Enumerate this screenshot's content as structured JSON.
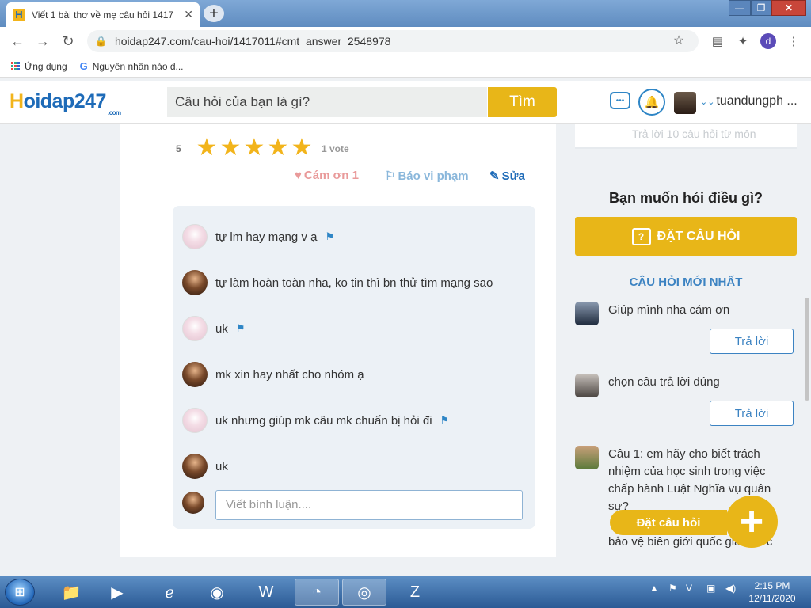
{
  "browser": {
    "tab_title": "Viết 1 bài thơ về mẹ câu hỏi 1417",
    "new_tab": "+",
    "url": "hoidap247.com/cau-hoi/1417011#cmt_answer_2548978",
    "profile_initial": "d",
    "bookmarks": [
      "Ứng dụng",
      "Nguyên nhân nào d..."
    ]
  },
  "site": {
    "logo_h": "H",
    "logo_rest": "oidap247",
    "logo_com": ".com",
    "search_placeholder": "Câu hỏi của bạn là gì?",
    "search_button": "Tìm",
    "username": "tuandungph ..."
  },
  "answer": {
    "rating": "5",
    "stars": 5,
    "votes": "1 vote",
    "thanks": "Cám ơn 1",
    "report": "Báo vi phạm",
    "edit": "Sửa"
  },
  "comments": [
    {
      "text": "tự lm hay mạng v ạ",
      "avatar": "a",
      "flag": true
    },
    {
      "text": "tự làm hoàn toàn nha, ko tin thì bn thử tìm mạng sao",
      "avatar": "b",
      "flag": false
    },
    {
      "text": "uk",
      "avatar": "a",
      "flag": true
    },
    {
      "text": "mk xin hay nhất cho nhóm ạ",
      "avatar": "b",
      "flag": false
    },
    {
      "text": "uk nhưng giúp mk câu mk chuẩn bị hỏi đi",
      "avatar": "a",
      "flag": true
    },
    {
      "text": "uk",
      "avatar": "b",
      "flag": false
    }
  ],
  "comment_input_placeholder": "Viết bình luận....",
  "sidebar": {
    "top_text": "Trả lời 10 câu hỏi từ môn",
    "ask_title": "Bạn muốn hỏi điều gì?",
    "ask_button": "ĐẶT CÂU HỎI",
    "newest_title": "CÂU HỎI MỚI NHẤT",
    "questions": [
      {
        "text": "Giúp mình nha cám ơn",
        "reply": "Trả lời"
      },
      {
        "text": "chọn câu trả lời đúng",
        "reply": "Trả lời"
      },
      {
        "text": "Câu 1: em hãy cho biết trách nhiệm của học sinh trong việc chấp hành Luật Nghĩa vụ quân sự?",
        "tail": "bảo vệ biên giới quốc gia nước"
      }
    ],
    "float_label": "Đặt câu hỏi",
    "fab": "+"
  },
  "taskbar": {
    "time": "2:15 PM",
    "date": "12/11/2020"
  },
  "colors": {
    "accent_yellow": "#e8b618",
    "brand_blue": "#1e6bb8"
  }
}
